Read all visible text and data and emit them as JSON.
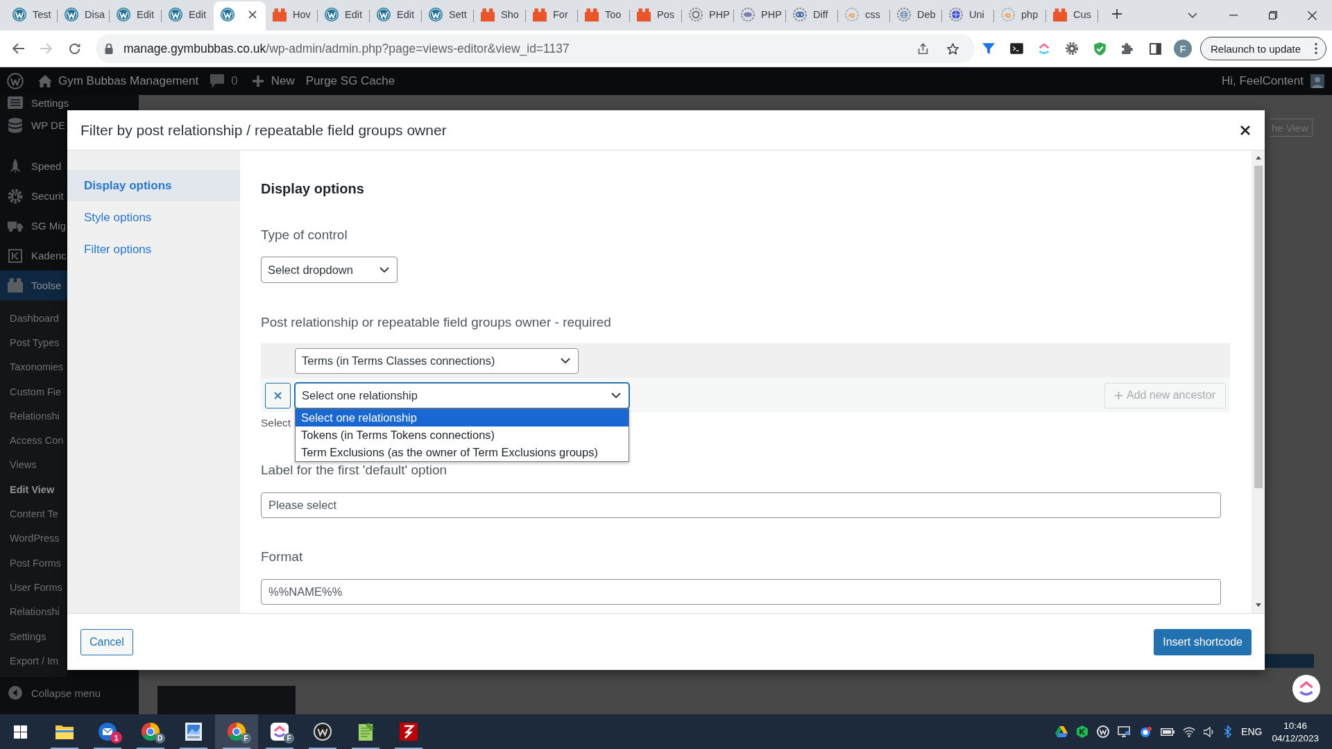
{
  "browser": {
    "tabs": [
      {
        "title": "Test",
        "selected": false
      },
      {
        "title": "Disa",
        "selected": false
      },
      {
        "title": "Edit",
        "selected": false
      },
      {
        "title": "Edit",
        "selected": false
      },
      {
        "selected": true
      },
      {
        "title": "Hov",
        "selected": false
      },
      {
        "title": "Edit",
        "selected": false
      },
      {
        "title": "Edit",
        "selected": false
      },
      {
        "title": "Sett",
        "selected": false
      },
      {
        "title": "Sho",
        "selected": false
      },
      {
        "title": "For",
        "selected": false
      },
      {
        "title": "Too",
        "selected": false
      },
      {
        "title": "Pos",
        "selected": false
      },
      {
        "title": "PHP",
        "selected": false
      },
      {
        "title": "PHP",
        "selected": false
      },
      {
        "title": "Diff",
        "selected": false
      },
      {
        "title": "css",
        "selected": false
      },
      {
        "title": "Deb",
        "selected": false
      },
      {
        "title": "Uni",
        "selected": false
      },
      {
        "title": "php",
        "selected": false
      },
      {
        "title": "Cus",
        "selected": false
      }
    ],
    "url": {
      "host": "manage.gymbubbas.co.uk",
      "path": "/wp-admin/admin.php?page=views-editor&view_id=1137"
    },
    "profile_initial": "F",
    "relaunch_button": "Relaunch to update"
  },
  "admin_bar": {
    "site_name": "Gym Bubbas Management",
    "comment_count": "0",
    "new_label": "New",
    "cache_label": "Purge SG Cache",
    "greeting": "Hi, FeelContent"
  },
  "admin_menu": {
    "items": [
      {
        "label": "Settings",
        "selected": false
      },
      {
        "label": "WP DE",
        "selected": false
      },
      {
        "label": "Speed",
        "selected": false
      },
      {
        "label": "Securit",
        "selected": false
      },
      {
        "label": "SG Mig",
        "selected": false
      },
      {
        "label": "Kadenc",
        "selected": false
      },
      {
        "label": "Toolse",
        "selected": true
      }
    ],
    "submenu": [
      {
        "label": "Dashboard",
        "selected": false
      },
      {
        "label": "Post Types",
        "selected": false
      },
      {
        "label": "Taxonomies",
        "selected": false
      },
      {
        "label": "Custom Fie",
        "selected": false
      },
      {
        "label": "Relationshi",
        "selected": false
      },
      {
        "label": "Access Con",
        "selected": false
      },
      {
        "label": "Views",
        "selected": false
      },
      {
        "label": "Edit View",
        "selected": true
      },
      {
        "label": "Content Te",
        "selected": false
      },
      {
        "label": "WordPress",
        "selected": false
      },
      {
        "label": "Post Forms",
        "selected": false
      },
      {
        "label": "User Forms",
        "selected": false
      },
      {
        "label": "Relationshi",
        "selected": false
      },
      {
        "label": "Settings",
        "selected": false
      },
      {
        "label": "Export / Im",
        "selected": false
      }
    ],
    "collapse_label": "Collapse menu"
  },
  "page": {
    "view_button": "he View"
  },
  "dialog": {
    "title": "Filter by post relationship / repeatable field groups owner",
    "nav": [
      {
        "label": "Display options",
        "selected": true
      },
      {
        "label": "Style options",
        "selected": false
      },
      {
        "label": "Filter options",
        "selected": false
      }
    ],
    "heading": "Display options",
    "control_type": {
      "label": "Type of control",
      "value": "Select dropdown"
    },
    "relationship": {
      "label": "Post relationship or repeatable field groups owner - required",
      "rows": [
        {
          "kind": "parent",
          "value": "Terms (in Terms Classes connections)",
          "expanded": false
        },
        {
          "kind": "ancestor",
          "value": "Select one relationship",
          "expanded": true,
          "options": [
            {
              "label": "Select one relationship",
              "selected": true
            },
            {
              "label": "Tokens (in Terms Tokens connections)",
              "selected": false
            },
            {
              "label": "Term Exclusions (as the owner of Term Exclusions groups)",
              "selected": false
            }
          ]
        }
      ],
      "add_button": {
        "label": "Add new ancestor",
        "disabled": true
      },
      "note": "Select"
    },
    "default_label": {
      "label": "Label for the first 'default' option",
      "value": "Please select"
    },
    "format": {
      "label": "Format",
      "value": "%%NAME%%"
    },
    "cancel_button": "Cancel",
    "insert_button": "Insert shortcode"
  },
  "taskbar": {
    "apps": [
      {
        "running": true,
        "selected": false
      },
      {
        "running": true,
        "selected": false,
        "badge": {
          "kind": "count",
          "text": "1"
        }
      },
      {
        "running": true,
        "selected": false,
        "badge": {
          "kind": "profile",
          "text": "D"
        }
      },
      {
        "running": true,
        "selected": false
      },
      {
        "running": true,
        "selected": true,
        "badge": {
          "kind": "profile",
          "text": "F"
        }
      },
      {
        "running": true,
        "selected": false,
        "badge": {
          "kind": "profile",
          "text": "F"
        }
      },
      {
        "running": true,
        "selected": false
      },
      {
        "running": true,
        "selected": false
      },
      {
        "running": true,
        "selected": false
      }
    ],
    "language": "ENG",
    "time": "10:46",
    "date": "04/12/2023"
  }
}
